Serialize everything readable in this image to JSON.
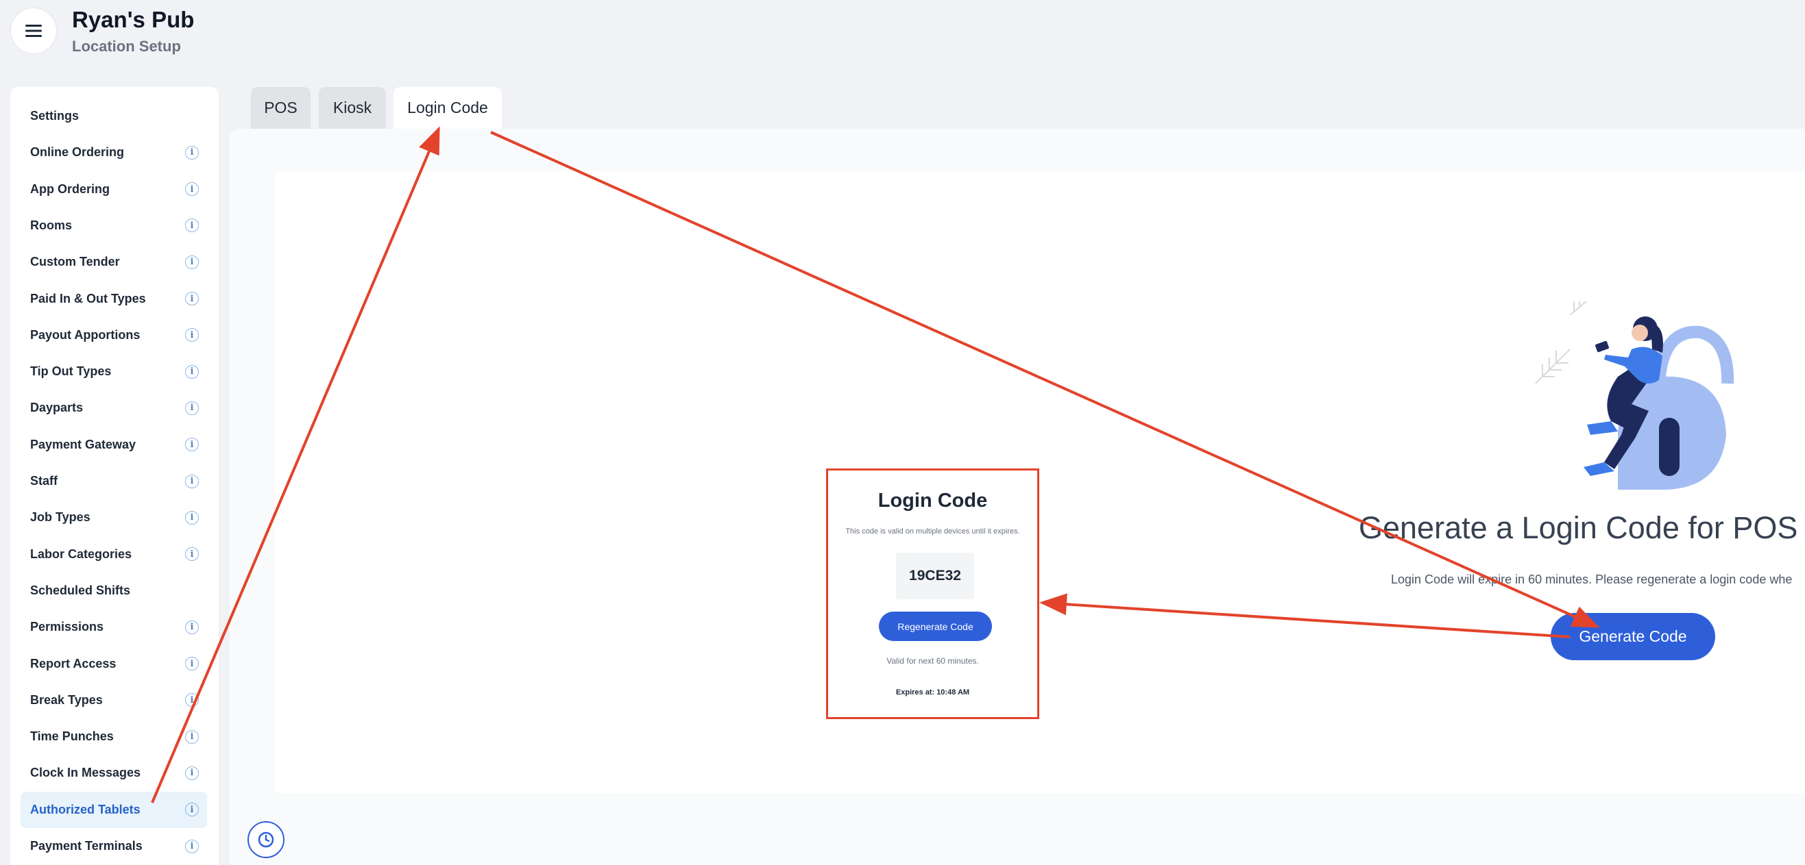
{
  "header": {
    "title": "Ryan's Pub",
    "subtitle": "Location Setup",
    "menu_icon": "hamburger-menu-icon"
  },
  "sidebar": {
    "items": [
      {
        "label": "Settings",
        "info": false,
        "active": false
      },
      {
        "label": "Online Ordering",
        "info": true,
        "active": false
      },
      {
        "label": "App Ordering",
        "info": true,
        "active": false
      },
      {
        "label": "Rooms",
        "info": true,
        "active": false
      },
      {
        "label": "Custom Tender",
        "info": true,
        "active": false
      },
      {
        "label": "Paid In & Out Types",
        "info": true,
        "active": false
      },
      {
        "label": "Payout Apportions",
        "info": true,
        "active": false
      },
      {
        "label": "Tip Out Types",
        "info": true,
        "active": false
      },
      {
        "label": "Dayparts",
        "info": true,
        "active": false
      },
      {
        "label": "Payment Gateway",
        "info": true,
        "active": false
      },
      {
        "label": "Staff",
        "info": true,
        "active": false
      },
      {
        "label": "Job Types",
        "info": true,
        "active": false
      },
      {
        "label": "Labor Categories",
        "info": true,
        "active": false
      },
      {
        "label": "Scheduled Shifts",
        "info": false,
        "active": false
      },
      {
        "label": "Permissions",
        "info": true,
        "active": false
      },
      {
        "label": "Report Access",
        "info": true,
        "active": false
      },
      {
        "label": "Break Types",
        "info": true,
        "active": false
      },
      {
        "label": "Time Punches",
        "info": true,
        "active": false
      },
      {
        "label": "Clock In Messages",
        "info": true,
        "active": false
      },
      {
        "label": "Authorized Tablets",
        "info": true,
        "active": true
      },
      {
        "label": "Payment Terminals",
        "info": true,
        "active": false
      }
    ],
    "info_glyph": "i"
  },
  "tabs": [
    {
      "label": "POS",
      "active": false
    },
    {
      "label": "Kiosk",
      "active": false
    },
    {
      "label": "Login Code",
      "active": true
    }
  ],
  "login_code": {
    "title": "Login Code",
    "note": "This code is valid on multiple devices until it expires.",
    "code": "19CE32",
    "regenerate_label": "Regenerate Code",
    "valid_text": "Valid for next 60 minutes.",
    "expires_text": "Expires at: 10:48 AM"
  },
  "generate": {
    "heading": "Generate a Login Code for POS a",
    "description": "Login Code will expire in 60 minutes. Please regenerate a login code whe",
    "button_label": "Generate Code"
  },
  "footer": {
    "clock_icon": "clock-icon"
  },
  "colors": {
    "accent": "#2e5fd9",
    "annotation": "#e3432b",
    "active_bg": "#e8f3fb",
    "active_text": "#2563c9"
  }
}
